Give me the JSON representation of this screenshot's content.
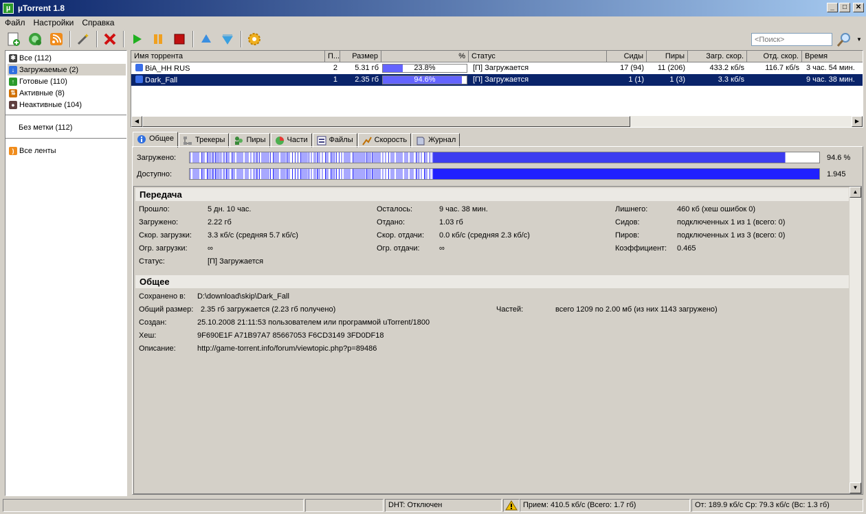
{
  "window": {
    "title": "µTorrent 1.8",
    "app_icon_letter": "µ"
  },
  "menu": [
    {
      "label": "Файл"
    },
    {
      "label": "Настройки"
    },
    {
      "label": "Справка"
    }
  ],
  "search": {
    "placeholder": "<Поиск>"
  },
  "sidebar": {
    "categories": [
      {
        "label": "Все (112)",
        "icon": "all-icon",
        "color": "#404040"
      },
      {
        "label": "Загружаемые (2)",
        "icon": "download-icon",
        "color": "#2f6fe0"
      },
      {
        "label": "Готовые (110)",
        "icon": "completed-icon",
        "color": "#2a9a2a"
      },
      {
        "label": "Активные (8)",
        "icon": "active-icon",
        "color": "#d07000"
      },
      {
        "label": "Неактивные (104)",
        "icon": "inactive-icon",
        "color": "#604040"
      }
    ],
    "selected_index": 1,
    "label_group": "Без метки (112)",
    "feeds": "Все ленты"
  },
  "list": {
    "columns": [
      "Имя торрента",
      "П...",
      "Размер",
      "%",
      "Статус",
      "Сиды",
      "Пиры",
      "Загр. скор.",
      "Отд. скор.",
      "Время"
    ],
    "rows": [
      {
        "name": "BiA_HH RUS",
        "num": "2",
        "size": "5.31 гб",
        "progress": 23.8,
        "percent": "23.8%",
        "status": "[П] Загружается",
        "seeds": "17 (94)",
        "peers": "11 (206)",
        "down": "433.2 кб/s",
        "up": "116.7 кб/s",
        "eta": "3 час. 54 мин."
      },
      {
        "name": "Dark_Fall",
        "num": "1",
        "size": "2.35 гб",
        "progress": 94.6,
        "percent": "94.6%",
        "status": "[П] Загружается",
        "seeds": "1 (1)",
        "peers": "1 (3)",
        "down": "3.3 кб/s",
        "up": "",
        "eta": "9 час. 38 мин."
      }
    ],
    "selected_index": 1
  },
  "tabs": [
    {
      "label": "Общее",
      "icon": "info-icon"
    },
    {
      "label": "Трекеры",
      "icon": "trackers-icon"
    },
    {
      "label": "Пиры",
      "icon": "peers-icon"
    },
    {
      "label": "Части",
      "icon": "pieces-icon"
    },
    {
      "label": "Файлы",
      "icon": "files-icon"
    },
    {
      "label": "Скорость",
      "icon": "speed-icon"
    },
    {
      "label": "Журнал",
      "icon": "log-icon"
    }
  ],
  "bars": {
    "downloaded_label": "Загружено:",
    "downloaded_value": "94.6 %",
    "available_label": "Доступно:",
    "available_value": "1.945"
  },
  "transfer": {
    "header": "Передача",
    "col1": [
      {
        "k": "Прошло:",
        "v": "5 дн. 10 час."
      },
      {
        "k": "Загружено:",
        "v": "2.22 гб"
      },
      {
        "k": "Скор. загрузки:",
        "v": "3.3 кб/с (средняя 5.7 кб/с)"
      },
      {
        "k": "Огр. загрузки:",
        "v": "∞"
      },
      {
        "k": "Статус:",
        "v": "[П] Загружается"
      }
    ],
    "col2": [
      {
        "k": "Осталось:",
        "v": "9 час. 38 мин."
      },
      {
        "k": "Отдано:",
        "v": "1.03 гб"
      },
      {
        "k": "Скор. отдачи:",
        "v": "0.0 кб/с (средняя 2.3 кб/с)"
      },
      {
        "k": "Огр. отдачи:",
        "v": "∞"
      }
    ],
    "col3": [
      {
        "k": "Лишнего:",
        "v": "460 кб (хеш ошибок 0)"
      },
      {
        "k": "Сидов:",
        "v": "подключенных 1 из 1 (всего: 0)"
      },
      {
        "k": "Пиров:",
        "v": "подключенных 1 из 3 (всего: 0)"
      },
      {
        "k": "Коэффициент:",
        "v": "0.465"
      }
    ]
  },
  "general": {
    "header": "Общее",
    "saved_k": "Сохранено в:",
    "saved_v": "D:\\download\\skip\\Dark_Fall",
    "size_k": "Общий размер:",
    "size_v": "2.35 гб загружается (2.23 гб получено)",
    "pieces_k": "Частей:",
    "pieces_v": "всего 1209 по 2.00 мб (из них 1143 загружено)",
    "created_k": "Создан:",
    "created_v": "25.10.2008 21:11:53 пользователем или программой uTorrent/1800",
    "hash_k": "Хеш:",
    "hash_v": "9F690E1F A71B97A7 85667053 F6CD3149 3FD0DF18",
    "desc_k": "Описание:",
    "desc_v": "http://game-torrent.info/forum/viewtopic.php?p=89486"
  },
  "status": {
    "dht": "DHT: Отключен",
    "down": "Прием: 410.5 кб/с (Всего: 1.7 гб)",
    "up": "От: 189.9 кб/с Ср: 79.3 кб/с (Вс: 1.3 гб)"
  },
  "colors": {
    "progress": "#6464ff",
    "bar_dark": "#2020ff",
    "bar_light": "#a8a8ff",
    "selection": "#0a246a"
  }
}
